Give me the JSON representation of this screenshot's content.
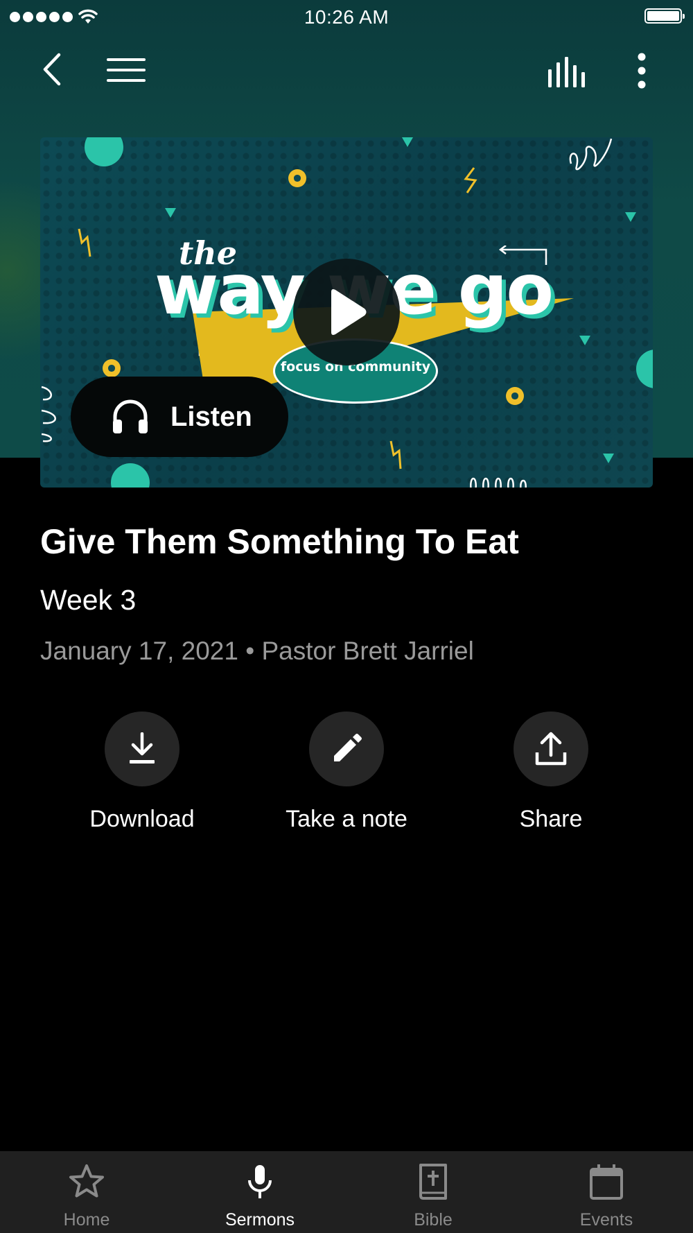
{
  "status_bar": {
    "time": "10:26 AM"
  },
  "nav": {
    "back_icon": "chevron-left-icon",
    "menu_icon": "hamburger-menu-icon",
    "audio_icon": "audio-levels-icon",
    "more_icon": "more-vertical-icon"
  },
  "media": {
    "artwork_title_small": "the",
    "artwork_title_main": "way we go",
    "artwork_tagline": "focus on community",
    "listen_label": "Listen",
    "colors": {
      "teal": "#2bc4a9",
      "yellow": "#f0c02a",
      "background": "#0d4a54"
    }
  },
  "sermon": {
    "title": "Give Them Something To Eat",
    "subtitle": "Week 3",
    "meta": "January 17, 2021 • Pastor Brett Jarriel"
  },
  "actions": [
    {
      "label": "Download",
      "icon": "download-icon"
    },
    {
      "label": "Take a note",
      "icon": "pencil-icon"
    },
    {
      "label": "Share",
      "icon": "share-icon"
    }
  ],
  "tabs": [
    {
      "label": "Home",
      "icon": "star-icon",
      "active": false
    },
    {
      "label": "Sermons",
      "icon": "microphone-icon",
      "active": true
    },
    {
      "label": "Bible",
      "icon": "bible-icon",
      "active": false
    },
    {
      "label": "Events",
      "icon": "calendar-icon",
      "active": false
    }
  ]
}
